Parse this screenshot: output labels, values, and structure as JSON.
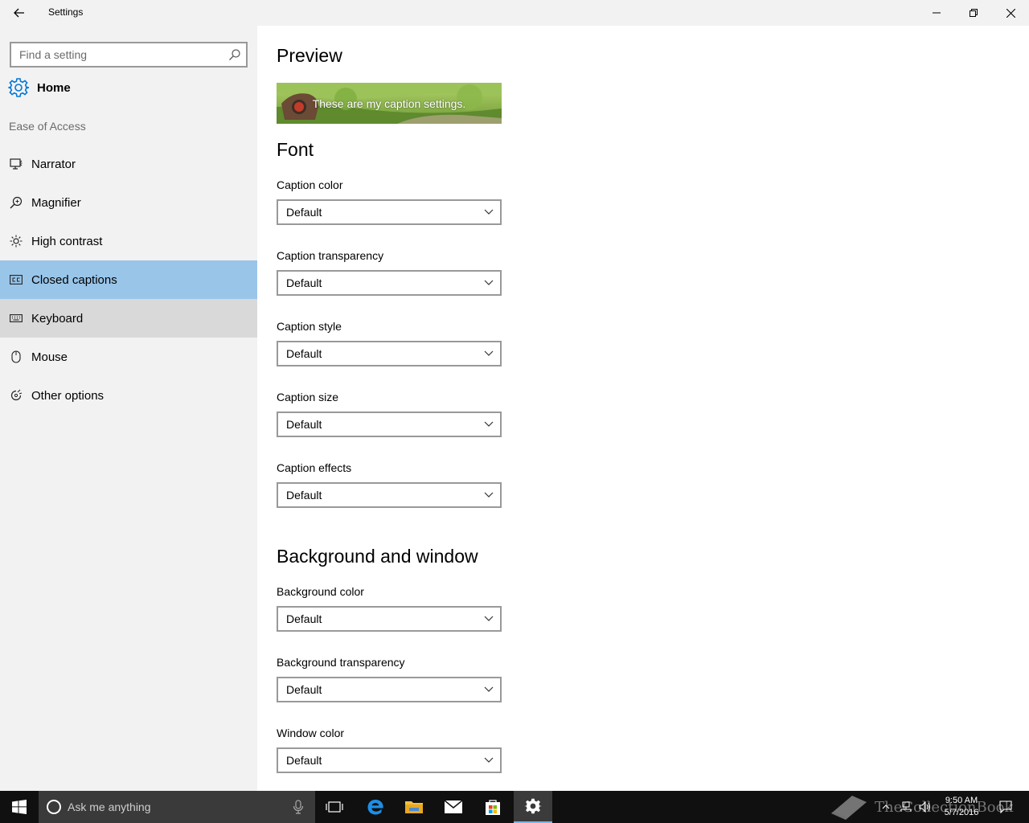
{
  "window": {
    "title": "Settings"
  },
  "sidebar": {
    "search_placeholder": "Find a setting",
    "home_label": "Home",
    "section_title": "Ease of Access",
    "items": [
      {
        "label": "Narrator",
        "icon": "narrator-icon",
        "state": "normal"
      },
      {
        "label": "Magnifier",
        "icon": "magnifier-icon",
        "state": "normal"
      },
      {
        "label": "High contrast",
        "icon": "high-contrast-icon",
        "state": "normal"
      },
      {
        "label": "Closed captions",
        "icon": "closed-captions-icon",
        "state": "selected"
      },
      {
        "label": "Keyboard",
        "icon": "keyboard-icon",
        "state": "hover"
      },
      {
        "label": "Mouse",
        "icon": "mouse-icon",
        "state": "normal"
      },
      {
        "label": "Other options",
        "icon": "other-options-icon",
        "state": "normal"
      }
    ]
  },
  "main": {
    "preview_heading": "Preview",
    "preview_caption": "These are my caption settings.",
    "font_heading": "Font",
    "font_fields": [
      {
        "label": "Caption color",
        "value": "Default"
      },
      {
        "label": "Caption transparency",
        "value": "Default"
      },
      {
        "label": "Caption style",
        "value": "Default"
      },
      {
        "label": "Caption size",
        "value": "Default"
      },
      {
        "label": "Caption effects",
        "value": "Default"
      }
    ],
    "background_heading": "Background and window",
    "background_fields": [
      {
        "label": "Background color",
        "value": "Default"
      },
      {
        "label": "Background transparency",
        "value": "Default"
      },
      {
        "label": "Window color",
        "value": "Default"
      }
    ]
  },
  "taskbar": {
    "search_text": "Ask me anything",
    "time": "9:50 AM",
    "date": "5/7/2016",
    "watermark_text": "TheCollectionBook"
  },
  "colors": {
    "accent": "#0078d7",
    "selected_nav": "#99c5e9",
    "hover_nav": "#d9d9d9",
    "sidebar_bg": "#f2f2f2",
    "taskbar_bg": "#101010"
  }
}
